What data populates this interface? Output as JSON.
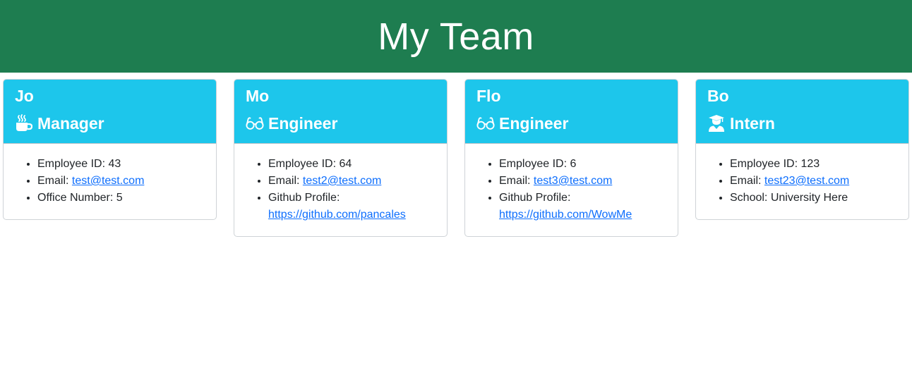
{
  "header": {
    "title": "My Team"
  },
  "cards": [
    {
      "name": "Jo",
      "role": "Manager",
      "role_icon": "mug-hot-icon",
      "id_label": "Employee ID: ",
      "id_value": "43",
      "email_label": "Email: ",
      "email": "test@test.com",
      "extra_label": "Office Number: ",
      "extra_value": "5"
    },
    {
      "name": "Mo",
      "role": "Engineer",
      "role_icon": "glasses-icon",
      "id_label": "Employee ID: ",
      "id_value": "64",
      "email_label": "Email: ",
      "email": "test2@test.com",
      "extra_label": "Github Profile:",
      "extra_link": "https://github.com/pancales"
    },
    {
      "name": "Flo",
      "role": "Engineer",
      "role_icon": "glasses-icon",
      "id_label": "Employee ID: ",
      "id_value": "6",
      "email_label": "Email: ",
      "email": "test3@test.com",
      "extra_label": "Github Profile:",
      "extra_link": "https://github.com/WowMe"
    },
    {
      "name": "Bo",
      "role": "Intern",
      "role_icon": "user-graduate-icon",
      "id_label": "Employee ID: ",
      "id_value": "123",
      "email_label": "Email: ",
      "email": "test23@test.com",
      "extra_label": "School: ",
      "extra_value": "University Here"
    }
  ],
  "colors": {
    "header_bg": "#1e7d50",
    "card_head_bg": "#1dc6eb",
    "link": "#0d6efd"
  }
}
